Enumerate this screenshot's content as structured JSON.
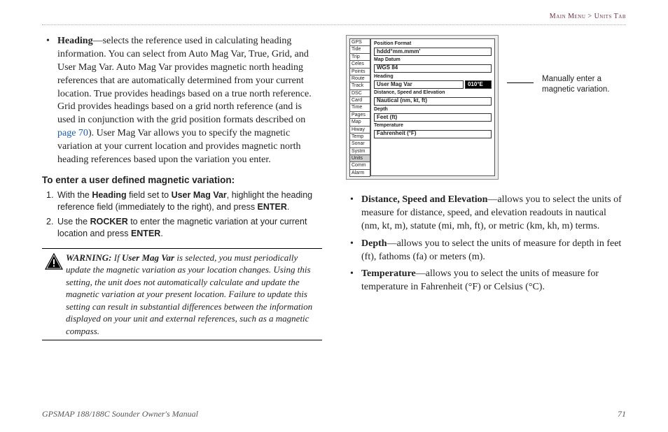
{
  "header": {
    "breadcrumb_left": "Main Menu",
    "gt": ">",
    "breadcrumb_right": "Units Tab"
  },
  "col1": {
    "heading_bullet": {
      "label": "Heading",
      "dash": "—",
      "body1": "selects the reference used in calculating heading information. You can select from Auto Mag Var, True, Grid, and User Mag Var. Auto Mag Var provides magnetic north heading references that are automatically determined from your current location. True provides headings based on a true north reference. Grid provides headings based on a grid north reference (and is used in conjunction with the grid position formats described on ",
      "page_link": "page 70",
      "body2": "). User Mag Var allows you to specify the magnetic variation at your current location and provides magnetic north heading references based upon the variation you enter."
    },
    "steps_title": "To enter a user defined magnetic variation:",
    "step1": {
      "num": "1.",
      "pre": "With the ",
      "b1": "Heading",
      "mid": " field set to ",
      "b2": "User Mag Var",
      "post": ", highlight the heading reference field (immediately to the right), and press ",
      "b3": "ENTER",
      "end": "."
    },
    "step2": {
      "num": "2.",
      "pre": "Use the ",
      "b1": "ROCKER",
      "mid": " to enter the magnetic variation at your current location and press ",
      "b2": "ENTER",
      "end": "."
    },
    "warning": {
      "label": "WARNING:",
      "if": " If ",
      "b1": "User Mag Var",
      "rest": " is selected, you must periodically update the magnetic variation as your location changes. Using this setting, the unit does not automatically calculate and update the magnetic variation at your present location. Failure to update this setting can result in substantial differences between the information displayed on your unit and external references, such as a magnetic compass."
    }
  },
  "col2": {
    "callout": "Manually enter a magnetic variation.",
    "distance_bullet": {
      "label": "Distance, Speed and Elevation",
      "dash": "—",
      "body": "allows you to select the units of measure for distance, speed, and elevation readouts in nautical (nm, kt, m), statute (mi, mh, ft), or metric (km, kh, m) terms."
    },
    "depth_bullet": {
      "label": "Depth",
      "dash": "—",
      "body": "allows you to select the units of measure for depth in feet (ft), fathoms (fa) or meters (m)."
    },
    "temperature_bullet": {
      "label": "Temperature",
      "dash": "—",
      "body": "allows you to select the units of measure for temperature in Fahrenheit (°F) or Celsius (°C)."
    }
  },
  "screenshot": {
    "tabs": [
      "GPS",
      "Tide",
      "Trip",
      "Celes",
      "Points",
      "Route",
      "Track",
      "DSC",
      "Card",
      "Time",
      "Pages",
      "Map",
      "Hiway",
      "Temp",
      "Sonar",
      "Systm",
      "Units",
      "Comm",
      "Alarm"
    ],
    "fields": {
      "f1l": "Position Format",
      "f1v": "hddd°mm.mmm'",
      "f2l": "Map Datum",
      "f2v": "WGS 84",
      "f3l": "Heading",
      "f3v": "User Mag Var",
      "f3v2": "010°E",
      "f4l": "Distance, Speed and Elevation",
      "f4v": "Nautical (nm, kt, ft)",
      "f5l": "Depth",
      "f5v": "Feet (ft)",
      "f6l": "Temperature",
      "f6v": "Fahrenheit (°F)"
    }
  },
  "footer": {
    "left": "GPSMAP 188/188C Sounder Owner's Manual",
    "right": "71"
  }
}
